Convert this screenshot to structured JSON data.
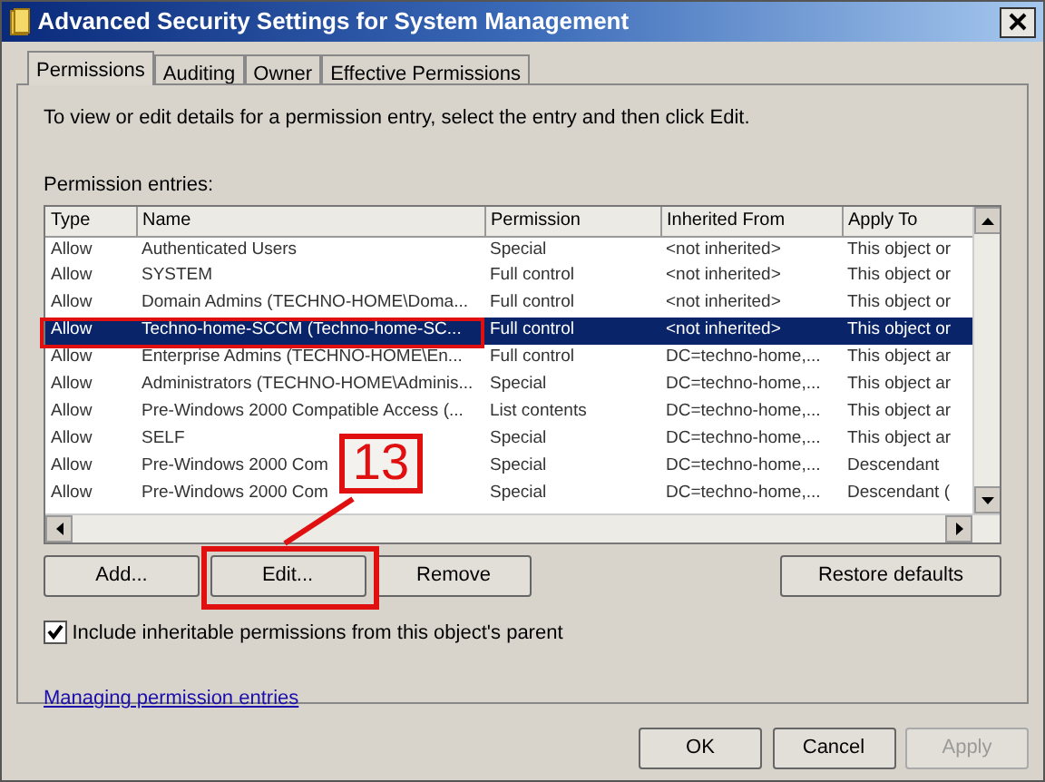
{
  "window": {
    "title": "Advanced Security Settings for System Management"
  },
  "tabs": [
    {
      "label": "Permissions",
      "selected": true
    },
    {
      "label": "Auditing",
      "selected": false
    },
    {
      "label": "Owner",
      "selected": false
    },
    {
      "label": "Effective Permissions",
      "selected": false
    }
  ],
  "instructions": "To view or edit details for a permission entry, select the entry and then click Edit.",
  "entries_label": "Permission entries:",
  "table": {
    "columns": [
      "Type",
      "Name",
      "Permission",
      "Inherited From",
      "Apply To"
    ],
    "rows": [
      {
        "cells": [
          "Allow",
          "Authenticated Users",
          "Special",
          "<not inherited>",
          "This object or"
        ],
        "selected": false,
        "highlighted": false
      },
      {
        "cells": [
          "Allow",
          "SYSTEM",
          "Full control",
          "<not inherited>",
          "This object or"
        ],
        "selected": false,
        "highlighted": false
      },
      {
        "cells": [
          "Allow",
          "Domain Admins (TECHNO-HOME\\Doma...",
          "Full control",
          "<not inherited>",
          "This object or"
        ],
        "selected": false,
        "highlighted": false
      },
      {
        "cells": [
          "Allow",
          "Techno-home-SCCM (Techno-home-SC...",
          "Full control",
          "<not inherited>",
          "This object or"
        ],
        "selected": true,
        "highlighted": true
      },
      {
        "cells": [
          "Allow",
          "Enterprise Admins (TECHNO-HOME\\En...",
          "Full control",
          "DC=techno-home,...",
          "This object ar"
        ],
        "selected": false,
        "highlighted": false
      },
      {
        "cells": [
          "Allow",
          "Administrators (TECHNO-HOME\\Adminis...",
          "Special",
          "DC=techno-home,...",
          "This object ar"
        ],
        "selected": false,
        "highlighted": false
      },
      {
        "cells": [
          "Allow",
          "Pre-Windows 2000 Compatible Access (...",
          "List contents",
          "DC=techno-home,...",
          "This object ar"
        ],
        "selected": false,
        "highlighted": false
      },
      {
        "cells": [
          "Allow",
          "SELF",
          "Special",
          "DC=techno-home,...",
          "This object ar"
        ],
        "selected": false,
        "highlighted": false
      },
      {
        "cells": [
          "Allow",
          "Pre-Windows 2000 Com",
          "Special",
          "DC=techno-home,...",
          "Descendant"
        ],
        "selected": false,
        "highlighted": false
      },
      {
        "cells": [
          "Allow",
          "Pre-Windows 2000 Com",
          "Special",
          "DC=techno-home,...",
          "Descendant ("
        ],
        "selected": false,
        "highlighted": false
      }
    ]
  },
  "entry_buttons": [
    {
      "label": "Add...",
      "highlighted": false
    },
    {
      "label": "Edit...",
      "highlighted": true
    },
    {
      "label": "Remove",
      "highlighted": false
    }
  ],
  "restore_button": "Restore defaults",
  "inherit_checkbox": {
    "label": "Include inheritable permissions from this object's parent",
    "checked": true
  },
  "help_link": "Managing permission entries",
  "dialog_buttons": [
    {
      "label": "OK",
      "disabled": false
    },
    {
      "label": "Cancel",
      "disabled": false
    },
    {
      "label": "Apply",
      "disabled": true
    }
  ],
  "annotation": {
    "label": "13"
  }
}
